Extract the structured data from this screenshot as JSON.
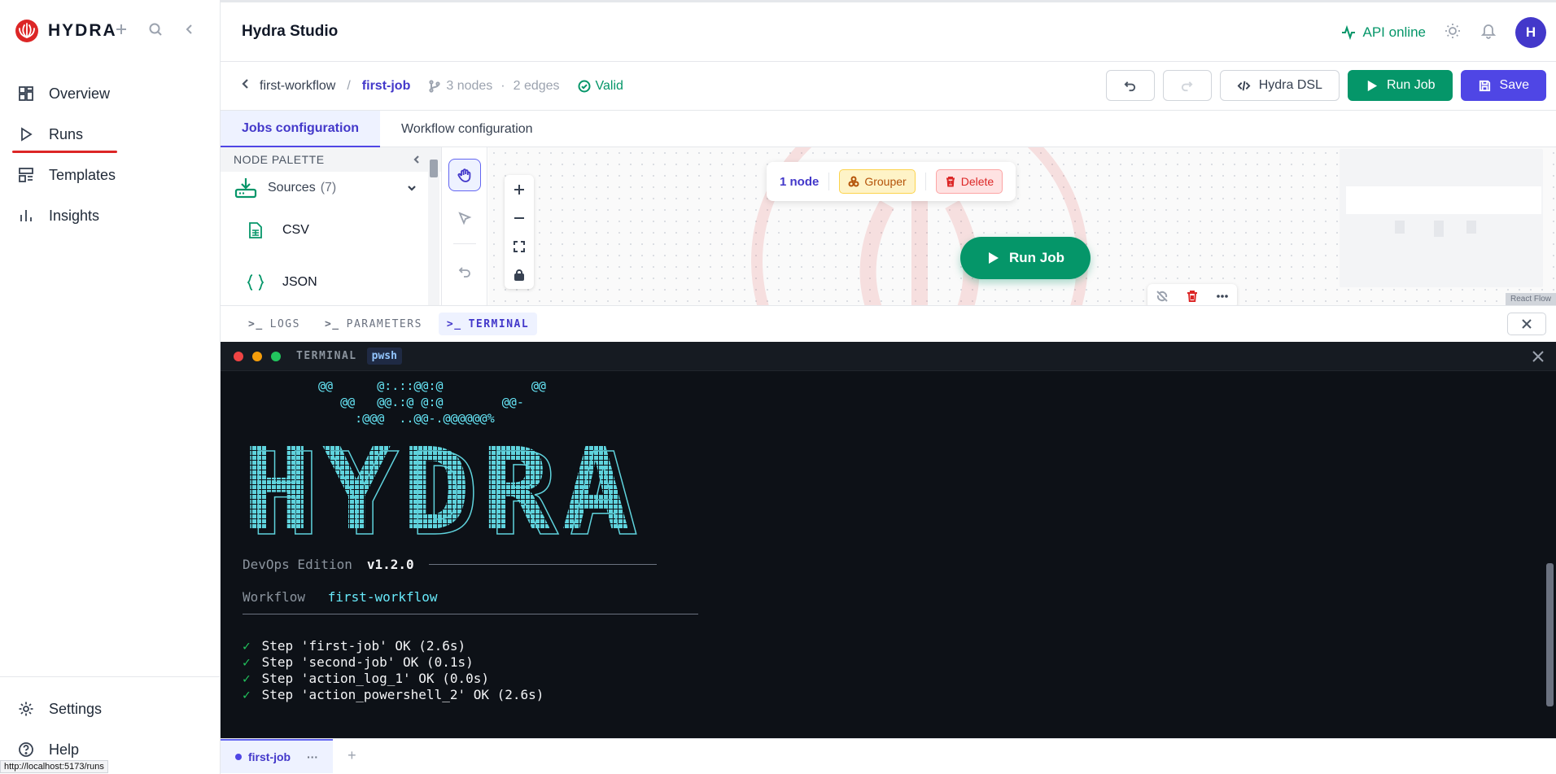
{
  "brand": {
    "name": "HYDRA"
  },
  "sidebar": {
    "items": [
      {
        "label": "Overview",
        "icon": "overview-icon"
      },
      {
        "label": "Runs",
        "icon": "play-icon",
        "active": true
      },
      {
        "label": "Templates",
        "icon": "templates-icon"
      },
      {
        "label": "Insights",
        "icon": "insights-icon"
      }
    ],
    "bottom": [
      {
        "label": "Settings",
        "icon": "gear-icon"
      },
      {
        "label": "Help",
        "icon": "help-icon"
      }
    ],
    "status_url": "http://localhost:5173/runs"
  },
  "header": {
    "title": "Hydra Studio",
    "api_status": "API online",
    "avatar_initial": "H"
  },
  "breadcrumb": {
    "parent": "first-workflow",
    "separator": "/",
    "current": "first-job",
    "nodes": "3 nodes",
    "dot": "·",
    "edges": "2 edges",
    "valid": "Valid"
  },
  "toolbar": {
    "dsl_label": "Hydra DSL",
    "run_label": "Run Job",
    "save_label": "Save"
  },
  "tabs": [
    {
      "label": "Jobs configuration",
      "active": true
    },
    {
      "label": "Workflow configuration",
      "active": false
    }
  ],
  "palette": {
    "title": "NODE PALETTE",
    "group_label": "Sources",
    "group_count": "(7)",
    "items": [
      {
        "label": "CSV",
        "icon": "csv-file-icon"
      },
      {
        "label": "JSON",
        "icon": "json-braces-icon"
      }
    ]
  },
  "canvas": {
    "selection_count": "1 node",
    "grouper_label": "Grouper",
    "delete_label": "Delete",
    "run_label": "Run Job",
    "attribution": "React Flow"
  },
  "panel_tabs": [
    {
      "prefix": ">_",
      "label": "LOGS",
      "active": false
    },
    {
      "prefix": ">_",
      "label": "PARAMETERS",
      "active": false
    },
    {
      "prefix": ">_",
      "label": "TERMINAL",
      "active": true
    }
  ],
  "terminal": {
    "title": "TERMINAL",
    "shell": "pwsh",
    "ascii": [
      "@@      @:.::@@:@            @@",
      "   @@   @@.:@ @:@        @@-",
      "     :@@@  ..@@-.@@@@@@%"
    ],
    "banner": "HYDRA",
    "edition_label": "DevOps Edition",
    "version": "v1.2.0",
    "workflow_label": "Workflow",
    "workflow_name": "first-workflow",
    "check": "✓",
    "steps": [
      "Step 'first-job' OK (2.6s)",
      "Step 'second-job' OK (0.1s)",
      "Step 'action_log_1' OK (0.0s)",
      "Step 'action_powershell_2' OK (2.6s)"
    ]
  },
  "job_tabs": {
    "active": "first-job",
    "more": "···",
    "add": "+"
  },
  "colors": {
    "accent": "#4f46e5",
    "success": "#059669",
    "danger": "#dc2626",
    "terminal_bg": "#0d1117",
    "terminal_cyan": "#67e8f9"
  }
}
